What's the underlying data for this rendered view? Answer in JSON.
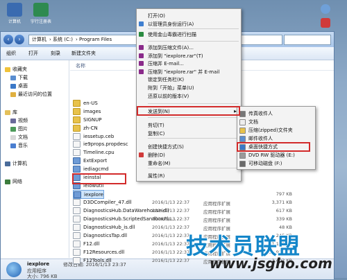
{
  "desktop": {
    "icons": [
      {
        "label": "计算机",
        "color": "#3a6bb0"
      },
      {
        "label": "宇行注册表",
        "color": "#2e8a50"
      }
    ],
    "right_icons": [
      "#6fa0d8",
      "#d03a3a",
      "#b8b8b8"
    ]
  },
  "explorer": {
    "breadcrumb": [
      "计算机",
      "系统 (C:)",
      "Program Files"
    ],
    "toolbar": [
      "组织",
      "打开",
      "刻录",
      "新建文件夹"
    ],
    "sidebar": {
      "favorites_header": "收藏夹",
      "favorites": [
        "下载",
        "桌面",
        "最近访问的位置"
      ],
      "libraries_header": "库",
      "libraries": [
        "视频",
        "图片",
        "文档",
        "音乐"
      ],
      "computer": "计算机",
      "network": "网络"
    },
    "columns": [
      "名称"
    ],
    "files": [
      {
        "name": "en-US",
        "kind": "folder"
      },
      {
        "name": "images",
        "kind": "folder"
      },
      {
        "name": "SIGNUP",
        "kind": "folder"
      },
      {
        "name": "zh-CN",
        "kind": "folder"
      },
      {
        "name": "iessetup.ceb",
        "kind": "file"
      },
      {
        "name": "ie9props.propdesc",
        "kind": "file"
      },
      {
        "name": "Timeline.cpu",
        "kind": "file"
      },
      {
        "name": "ExtExport",
        "kind": "exe"
      },
      {
        "name": "iediagcmd",
        "kind": "exe"
      },
      {
        "name": "ieinstal",
        "kind": "exe"
      },
      {
        "name": "ielowutil",
        "kind": "exe"
      },
      {
        "name": "iexplore",
        "kind": "exe",
        "date": "",
        "type": "",
        "size": "797 KB"
      },
      {
        "name": "D3DCompiler_47.dll",
        "kind": "file",
        "date": "2016/1/13 22:37",
        "type": "应用程序扩展",
        "size": "3,371 KB"
      },
      {
        "name": "DiagnosticsHub.DataWarehouse.dll",
        "kind": "file",
        "date": "2016/1/13 22:37",
        "type": "应用程序扩展",
        "size": "617 KB"
      },
      {
        "name": "DiagnosticsHub.ScriptedSandboxPlu...",
        "kind": "file",
        "date": "2016/1/13 22:37",
        "type": "应用程序扩展",
        "size": "339 KB"
      },
      {
        "name": "DiagnosticsHub_is.dll",
        "kind": "file",
        "date": "2016/1/13 22:37",
        "type": "应用程序扩展",
        "size": "48 KB"
      },
      {
        "name": "DiagnosticsTap.dll",
        "kind": "file",
        "date": "2016/1/13 22:37",
        "type": "应用程序扩展",
        "size": "245 KB"
      },
      {
        "name": "F12.dll",
        "kind": "file",
        "date": "2016/1/13 22:37",
        "type": "应用程序扩展",
        "size": "1,183 KB"
      },
      {
        "name": "F12Resources.dll",
        "kind": "file",
        "date": "2016/1/13 22:37",
        "type": "应用程序扩展",
        "size": "10,915 KB"
      },
      {
        "name": "F12Tools.dll",
        "kind": "file",
        "date": "2016/1/13 22:37",
        "type": "应用程序扩展",
        "size": "2,402 KB"
      }
    ],
    "details": {
      "name": "iexplore",
      "modified_label": "修改日期: 2016/1/13 23:37",
      "type_label": "应用程序",
      "size_label": "大小: 796 KB"
    }
  },
  "context_menu": {
    "items": [
      "打开(O)",
      "以管理员身份运行(A)",
      "使用金山毒霸进行扫描",
      "添加到压缩文件(A)...",
      "添加到 \"iexplore.rar\"(T)",
      "压缩并 E-mail...",
      "压缩到 \"iexplore.rar\" 并 E-mail",
      "锁定到任务栏(K)",
      "附到「开始」菜单(U)",
      "还原以前的版本(V)",
      "发送到(N)",
      "剪切(T)",
      "复制(C)",
      "创建快捷方式(S)",
      "删除(D)",
      "重命名(M)",
      "属性(R)"
    ]
  },
  "sendto_menu": {
    "items": [
      "传真收件人",
      "文档",
      "压缩(zipped)文件夹",
      "邮件收件人",
      "桌面快捷方式",
      "DVD RW 驱动器 (E:)",
      "可移动磁盘 (F:)"
    ]
  },
  "highlight_color": "#d22a2a",
  "watermark": {
    "title": "技术员联盟",
    "url": "www.jsgho.com"
  }
}
